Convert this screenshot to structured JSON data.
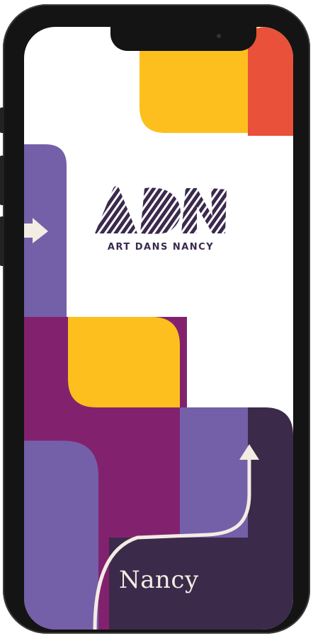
{
  "app": {
    "logo_letters": "ADN",
    "logo_subtitle": "ART DANS NANCY",
    "city_signature": "Nancy"
  },
  "colors": {
    "yellow": "#fcbf1d",
    "orange": "#e9513a",
    "purple_light": "#7460a8",
    "magenta": "#82226f",
    "deep_purple": "#3c2a4a",
    "cream": "#f3ece3",
    "logo_ink": "#3b2a4d"
  },
  "icons": {
    "arrow_left": "arrow-right-icon",
    "arrow_up": "arrow-up-icon"
  }
}
